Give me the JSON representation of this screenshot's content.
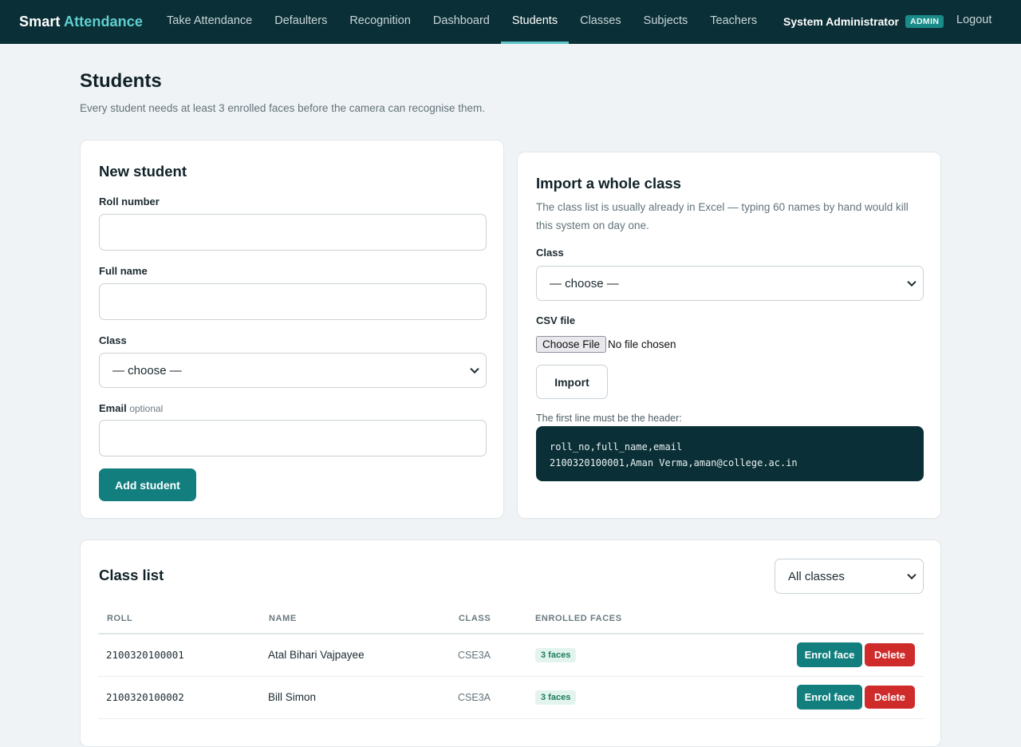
{
  "brand": {
    "first": "Smart",
    "second": "Attendance"
  },
  "nav": {
    "items": [
      {
        "label": "Take Attendance",
        "active": false
      },
      {
        "label": "Defaulters",
        "active": false
      },
      {
        "label": "Recognition",
        "active": false
      },
      {
        "label": "Dashboard",
        "active": false
      },
      {
        "label": "Students",
        "active": true
      },
      {
        "label": "Classes",
        "active": false
      },
      {
        "label": "Subjects",
        "active": false
      },
      {
        "label": "Teachers",
        "active": false
      }
    ],
    "user_name": "System Administrator",
    "role_badge": "ADMIN",
    "logout": "Logout"
  },
  "page": {
    "title": "Students",
    "subtitle": "Every student needs at least 3 enrolled faces before the camera can recognise them."
  },
  "new_student": {
    "heading": "New student",
    "roll_label": "Roll number",
    "roll_value": "",
    "name_label": "Full name",
    "name_value": "",
    "class_label": "Class",
    "class_selected": "— choose —",
    "email_label": "Email",
    "email_optional": "optional",
    "email_value": "",
    "submit": "Add student"
  },
  "import": {
    "heading": "Import a whole class",
    "description_line1": "The class list is usually already in Excel — typing 60 names by hand would kill",
    "description_line2": "this system on day one.",
    "class_label": "Class",
    "class_selected": "— choose —",
    "csv_label": "CSV file",
    "file_button": "Choose File",
    "file_status": "No file chosen",
    "submit": "Import",
    "hint": "The first line must be the header:",
    "sample_line1": "roll_no,full_name,email",
    "sample_line2": "2100320100001,Aman Verma,aman@college.ac.in"
  },
  "class_list": {
    "heading": "Class list",
    "filter_selected": "All classes",
    "columns": [
      "ROLL",
      "NAME",
      "CLASS",
      "ENROLLED FACES"
    ],
    "rows": [
      {
        "roll": "2100320100001",
        "name": "Atal Bihari Vajpayee",
        "class": "CSE3A",
        "faces": "3 faces"
      },
      {
        "roll": "2100320100002",
        "name": "Bill Simon",
        "class": "CSE3A",
        "faces": "3 faces"
      }
    ],
    "enrol_label": "Enrol face",
    "delete_label": "Delete"
  }
}
